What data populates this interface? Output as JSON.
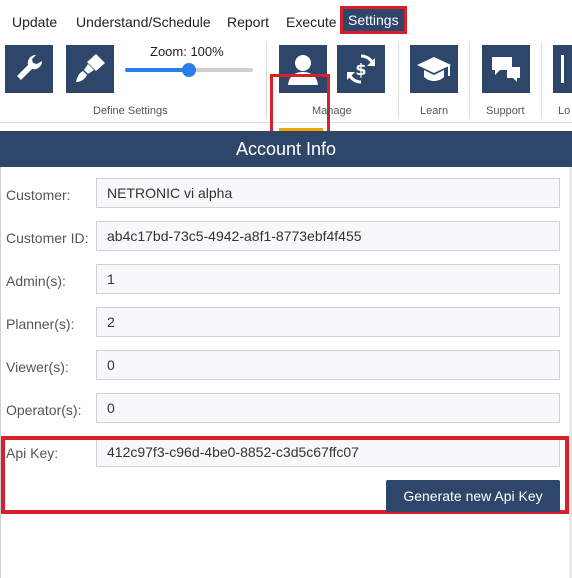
{
  "menu": {
    "items": [
      "Update",
      "Understand/Schedule",
      "Report",
      "Execute",
      "Settings"
    ]
  },
  "ribbon": {
    "zoom_label": "Zoom: 100%",
    "zoom_percent": 100,
    "zoom_slider_fraction": 0.5,
    "groups": {
      "define_settings": "Define Settings",
      "manage": "Manage",
      "learn": "Learn",
      "support": "Support",
      "log": "Lo"
    },
    "icons": [
      "wrench-icon",
      "paint-brush-icon",
      "user-icon",
      "currency-refresh-icon",
      "graduation-cap-icon",
      "chat-icon",
      "logout-icon"
    ]
  },
  "header": {
    "title": "Account Info"
  },
  "form": {
    "rows": [
      {
        "label": "Customer:",
        "value": "NETRONIC vi alpha"
      },
      {
        "label": "Customer ID:",
        "value": "ab4c17bd-73c5-4942-a8f1-8773ebf4f455"
      },
      {
        "label": "Admin(s):",
        "value": "1"
      },
      {
        "label": "Planner(s):",
        "value": "2"
      },
      {
        "label": "Viewer(s):",
        "value": "0"
      },
      {
        "label": "Operator(s):",
        "value": "0"
      },
      {
        "label": "Api Key:",
        "value": "412c97f3-c96d-4be0-8852-c3d5c67ffc07"
      }
    ],
    "generate_button": "Generate new Api Key"
  },
  "colors": {
    "accent": "#2f466b",
    "highlight": "#d6202a",
    "slider": "#2b7de9",
    "active_indicator": "#f0a500"
  }
}
